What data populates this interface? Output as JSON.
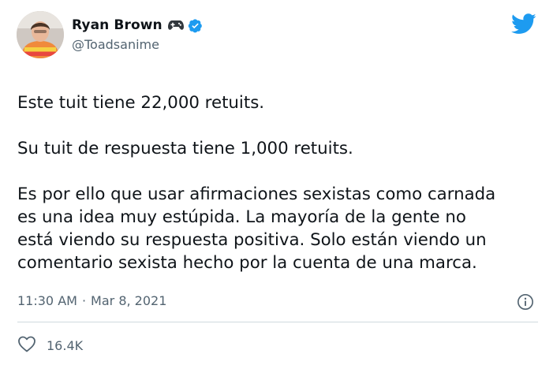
{
  "author": {
    "display_name": "Ryan Brown",
    "handle": "@Toadsanime",
    "verified": true,
    "name_emoji_icon": "gamepad-icon",
    "avatar_icon": "profile-photo"
  },
  "brand_icon": "twitter-bird-icon",
  "tweet": {
    "paragraphs": [
      [
        "Este tuit tiene 22,000 retuits."
      ],
      [
        "Su tuit de respuesta tiene 1,000 retuits."
      ],
      [
        "Es por ello que usar afirmaciones sexistas como carnada",
        "es una idea muy estúpida. La mayoría de la gente no",
        "está viendo su respuesta positiva. Solo están viendo un",
        "comentario sexista hecho por la cuenta de una marca."
      ]
    ],
    "time": "11:30 AM",
    "separator": "·",
    "date": "Mar 8, 2021"
  },
  "engagement": {
    "likes_icon": "heart-icon",
    "likes": "16.4K"
  },
  "colors": {
    "text": "#0f1419",
    "secondary": "#536471",
    "twitter_blue": "#1d9bf0",
    "divider": "#cfd9de"
  }
}
